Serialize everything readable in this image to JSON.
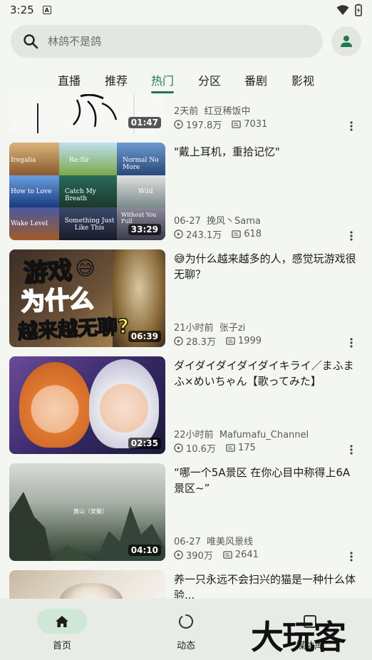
{
  "status_bar": {
    "time": "3:25",
    "notification_icon": "A"
  },
  "search": {
    "placeholder": "林鸽不是鸽"
  },
  "tabs": [
    {
      "label": "直播"
    },
    {
      "label": "推荐"
    },
    {
      "label": "热门"
    },
    {
      "label": "分区"
    },
    {
      "label": "番剧"
    },
    {
      "label": "影视"
    }
  ],
  "active_tab": "热门",
  "videos": [
    {
      "title": "",
      "duration": "01:47",
      "time": "2天前",
      "author": "红豆稀饭中",
      "views": "197.8万",
      "danmaku": "7031"
    },
    {
      "title": "\"戴上耳机，重拾记忆\"",
      "duration": "33:29",
      "time": "06-27",
      "author": "挽风丶Sama",
      "views": "243.1万",
      "danmaku": "618",
      "thumb_text": [
        "Iregalia",
        "Re:Sir",
        "Normal No More",
        "How to Love",
        "Catch My Breath",
        "Wild",
        "Wake Level",
        "Something Just Like This",
        "Without You Full"
      ]
    },
    {
      "title": "😅为什么越来越多的人，感觉玩游戏很无聊？",
      "duration": "06:39",
      "time": "21小时前",
      "author": "张子zi",
      "views": "28.3万",
      "danmaku": "1999",
      "thumb_text": [
        "游戏",
        "为什么",
        "越来越无聊?"
      ]
    },
    {
      "title": "ダイダイダイダイダイキライ／まふまふ×めいちゃん【歌ってみた】",
      "duration": "02:35",
      "time": "22小时前",
      "author": "Mafumafu_Channel",
      "views": "10.6万",
      "danmaku": "175"
    },
    {
      "title": "“哪一个5A景区 在你心目中称得上6A景区~”",
      "duration": "04:10",
      "time": "06-27",
      "author": "唯美风景线",
      "views": "390万",
      "danmaku": "2641",
      "thumb_text": [
        "黄山（安徽）"
      ]
    },
    {
      "title": "养一只永远不会扫兴的猫是一种什么体验...",
      "duration": "",
      "time": "",
      "author": "",
      "views": "",
      "danmaku": ""
    }
  ],
  "bottom_nav": [
    {
      "label": "首页",
      "icon": "home-icon"
    },
    {
      "label": "动态",
      "icon": "dynamic-icon"
    },
    {
      "label": "媒体库",
      "icon": "library-icon"
    }
  ],
  "watermark": "大玩客",
  "colors": {
    "accent": "#1e7a4c",
    "background": "#f4f6f2",
    "nav_active_pill": "#cfe8d5"
  }
}
